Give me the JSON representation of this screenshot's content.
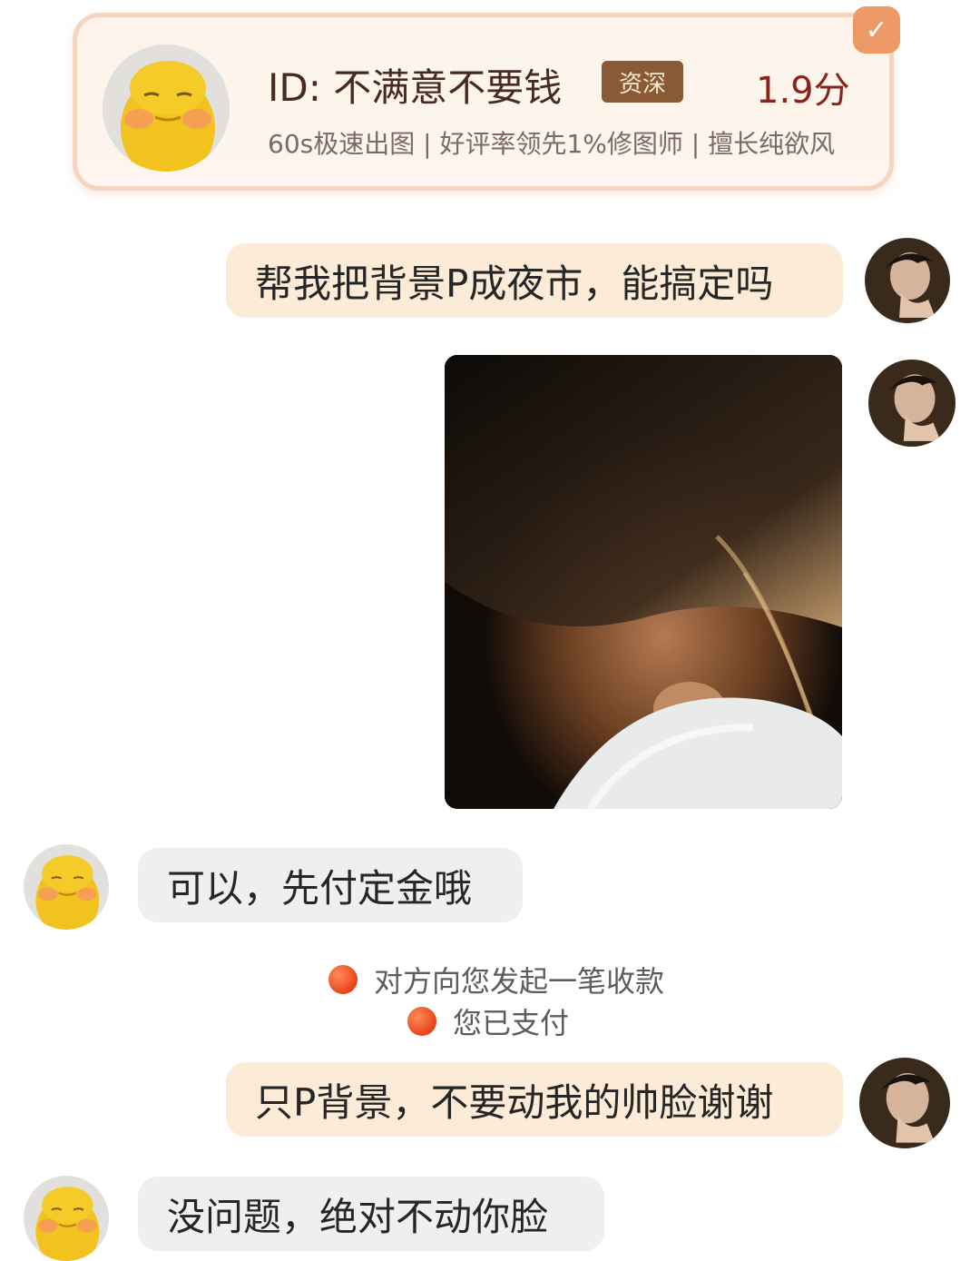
{
  "profile_card": {
    "id_text": "ID: 不满意不要钱",
    "badge": "资深",
    "score": "1.9分",
    "description": "60s极速出图 | 好评率领先1%修图师 | 擅长纯欲风",
    "check_icon": "check-icon"
  },
  "messages": [
    {
      "side": "me",
      "text": "帮我把背景P成夜市，能搞定吗"
    },
    {
      "side": "me",
      "type": "image",
      "icon": "photo-image"
    },
    {
      "side": "them",
      "text": "可以，先付定金哦"
    },
    {
      "side": "me",
      "text": "只P背景，不要动我的帅脸谢谢"
    },
    {
      "side": "them",
      "text": "没问题，绝对不动你脸"
    }
  ],
  "system": {
    "payment_request": "对方向您发起一笔收款",
    "payment_done": "您已支付"
  },
  "colors": {
    "my_bubble": "#fcebd6",
    "their_bubble": "#efefef",
    "card_border": "#f6d5bf",
    "badge_bg": "#8a5a35",
    "score": "#8a2318",
    "status_dot": "#e8431a"
  }
}
